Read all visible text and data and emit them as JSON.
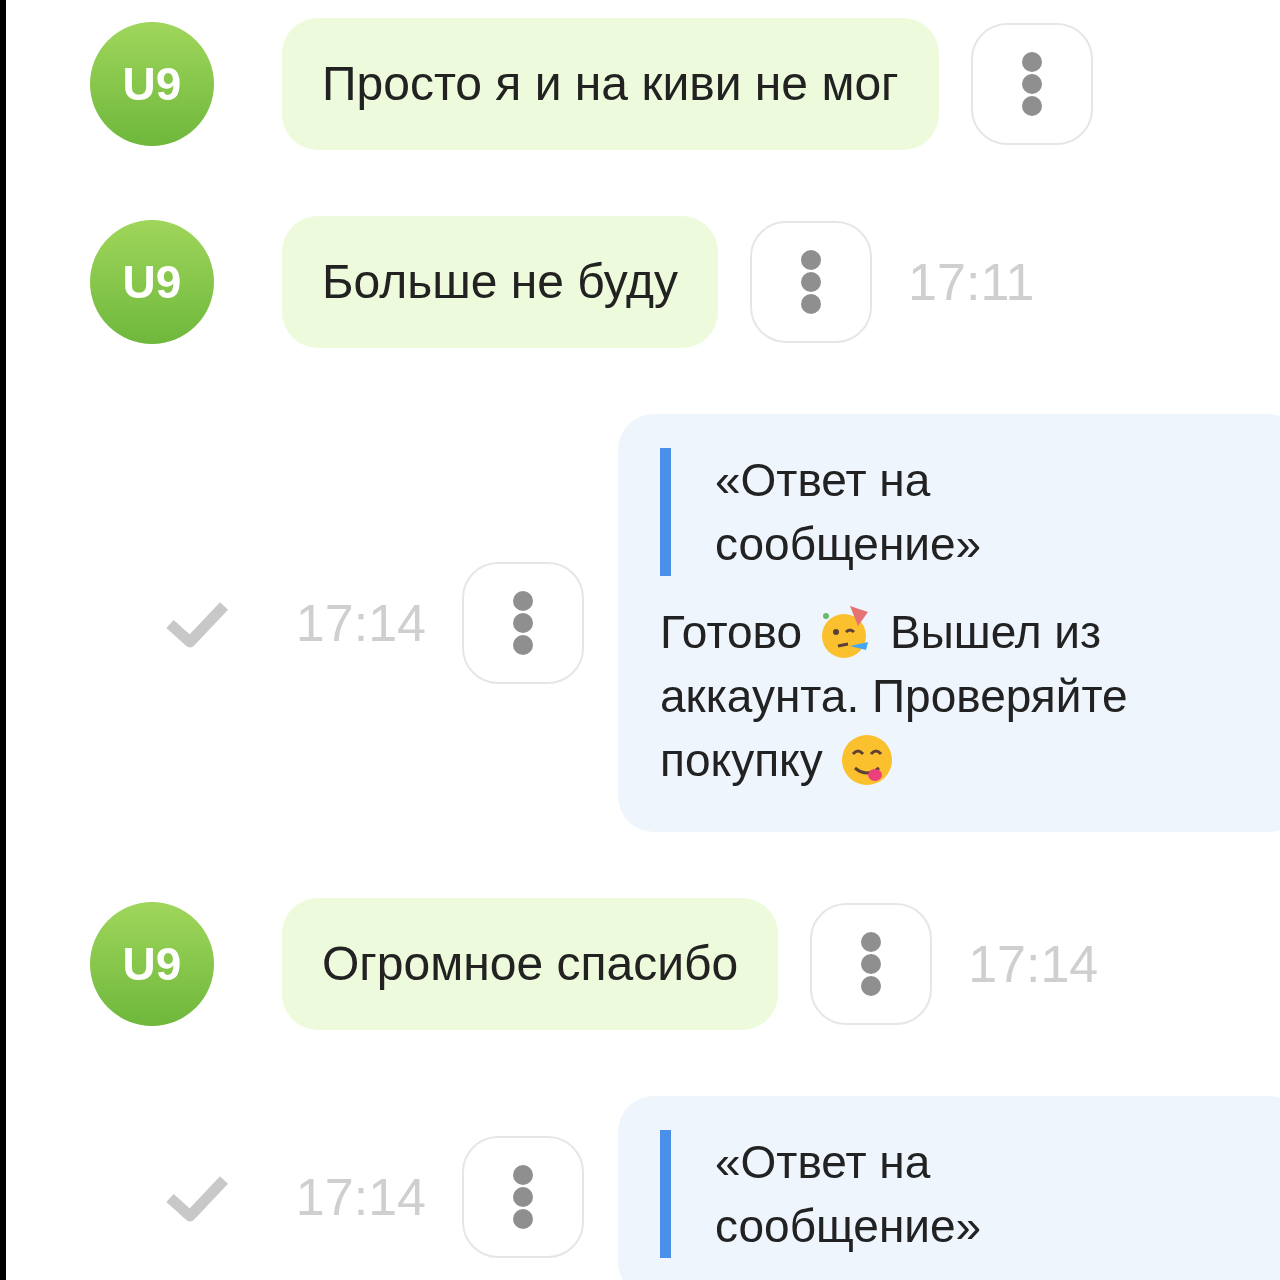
{
  "messages": [
    {
      "kind": "incoming",
      "avatar": "U9",
      "text": "Просто я и на киви не мог"
    },
    {
      "kind": "incoming",
      "avatar": "U9",
      "text": "Больше не буду",
      "time": "17:11"
    },
    {
      "kind": "outgoing",
      "read": true,
      "time": "17:14",
      "quote": "«Ответ на сообщение»",
      "body": [
        [
          {
            "kind": "text",
            "text": "Готово"
          },
          {
            "kind": "party-emoji"
          },
          {
            "kind": "text",
            "text": "Вышел из"
          }
        ],
        [
          {
            "kind": "text",
            "text": "аккаунта. Проверяйте"
          }
        ],
        [
          {
            "kind": "text",
            "text": "покупку"
          },
          {
            "kind": "yum-emoji"
          }
        ]
      ]
    },
    {
      "kind": "incoming",
      "avatar": "U9",
      "text": "Огромное спасибо",
      "time": "17:14"
    },
    {
      "kind": "outgoing",
      "read": true,
      "time": "17:14",
      "quote": "«Ответ на сообщение»"
    }
  ]
}
